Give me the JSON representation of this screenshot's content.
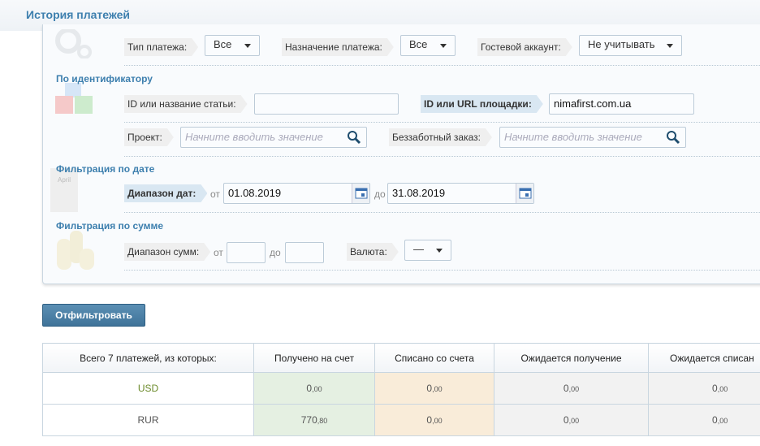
{
  "header": {
    "title": "История платежей"
  },
  "filters": {
    "payment_type": {
      "label": "Тип платежа:",
      "value": "Все"
    },
    "purpose": {
      "label": "Назначение платежа:",
      "value": "Все"
    },
    "guest": {
      "label": "Гостевой аккаунт:",
      "value": "Не учитывать"
    },
    "by_id": {
      "title": "По идентификатору",
      "article_label": "ID или название статьи:",
      "article_value": "",
      "site_label": "ID или URL площадки:",
      "site_value": "nimafirst.com.ua",
      "project_label": "Проект:",
      "project_placeholder": "Начните вводить значение",
      "order_label": "Беззаботный заказ:",
      "order_placeholder": "Начните вводить значение"
    },
    "by_date": {
      "title": "Фильтрация по дате",
      "label": "Диапазон дат:",
      "from": "от",
      "from_value": "01.08.2019",
      "to": "до",
      "to_value": "31.08.2019",
      "calendar_text": "April"
    },
    "by_sum": {
      "title": "Фильтрация по сумме",
      "label": "Диапазон сумм:",
      "from": "от",
      "to": "до",
      "currency_label": "Валюта:",
      "currency_value": "—"
    }
  },
  "filter_button": "Отфильтровать",
  "table": {
    "headers": [
      "Всего 7 платежей, из которых:",
      "Получено на счет",
      "Списано со счета",
      "Ожидается получение",
      "Ожидается списан"
    ],
    "rows": [
      {
        "currency": "USD",
        "values": [
          [
            "0",
            ",00"
          ],
          [
            "0",
            ",00"
          ],
          [
            "0",
            ",00"
          ],
          [
            "0",
            ",00"
          ]
        ]
      },
      {
        "currency": "RUR",
        "values": [
          [
            "770",
            ",80"
          ],
          [
            "0",
            ",00"
          ],
          [
            "0",
            ",00"
          ],
          [
            "0",
            ",00"
          ]
        ]
      }
    ]
  },
  "colors": {
    "accent": "#3d7fae",
    "received": "#e5f0e2",
    "written_off": "#f9ecd9",
    "pending": "#f2f2f2"
  }
}
